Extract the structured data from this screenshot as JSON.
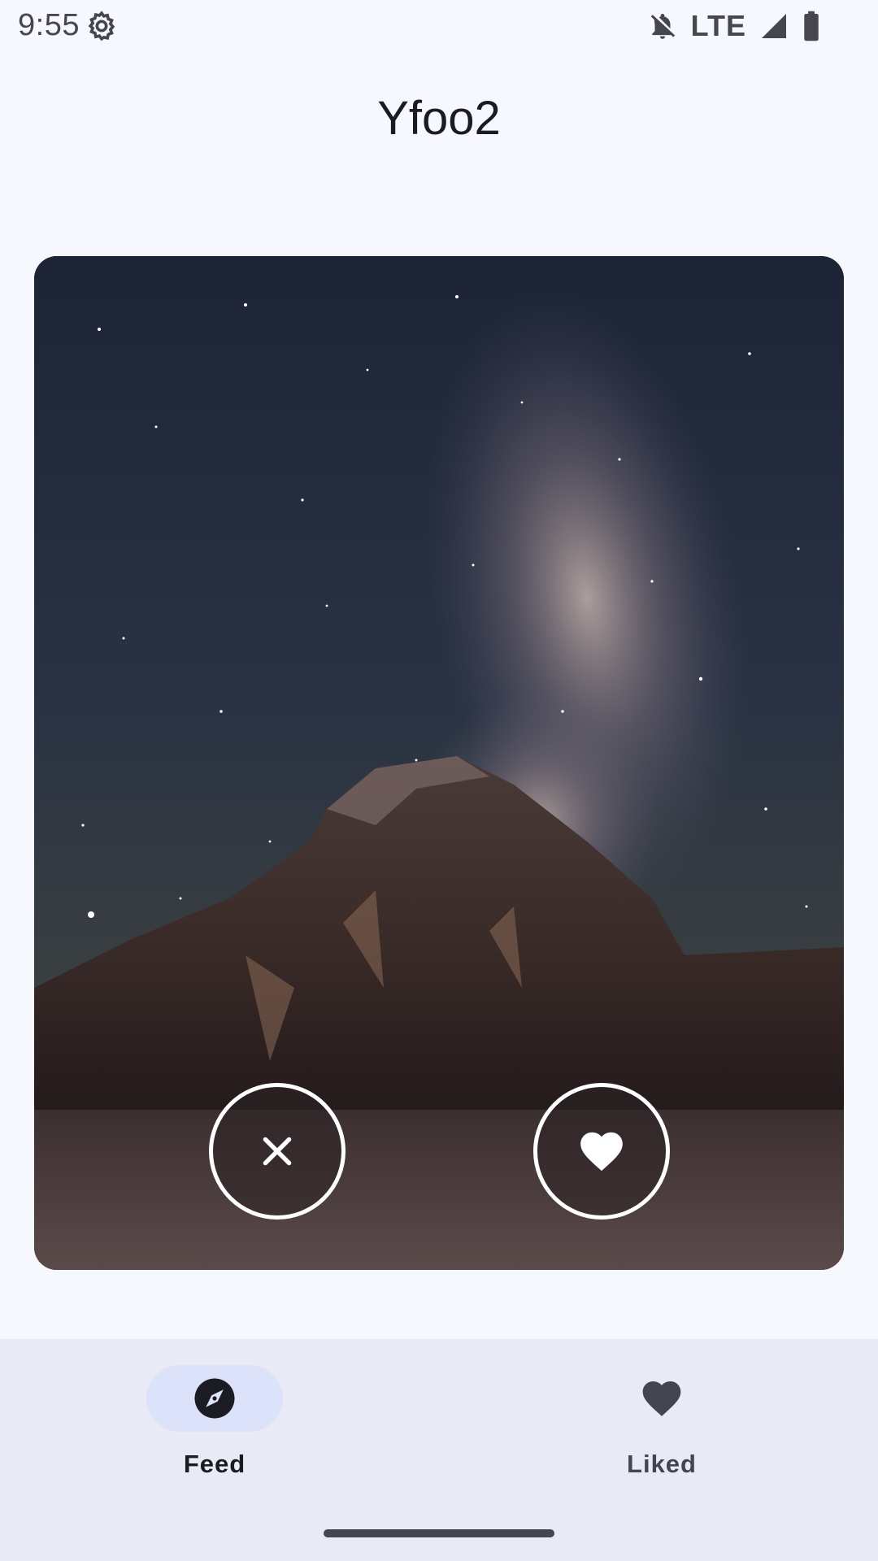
{
  "status_bar": {
    "time": "9:55",
    "network": "LTE",
    "icons": [
      "settings-gear-icon",
      "notifications-off-icon",
      "signal-icon",
      "battery-icon"
    ]
  },
  "app": {
    "title": "Yfoo2"
  },
  "card": {
    "image_subject": "milky-way-over-mountain",
    "actions": {
      "dislike_icon": "close-icon",
      "like_icon": "heart-icon"
    }
  },
  "bottom_nav": {
    "items": [
      {
        "label": "Feed",
        "icon": "compass-icon",
        "selected": true
      },
      {
        "label": "Liked",
        "icon": "heart-icon",
        "selected": false
      }
    ]
  },
  "colors": {
    "background": "#f7f8fe",
    "nav_background": "#e9eaf5",
    "nav_indicator": "#dde2fb",
    "text_primary": "#1b1c22"
  }
}
